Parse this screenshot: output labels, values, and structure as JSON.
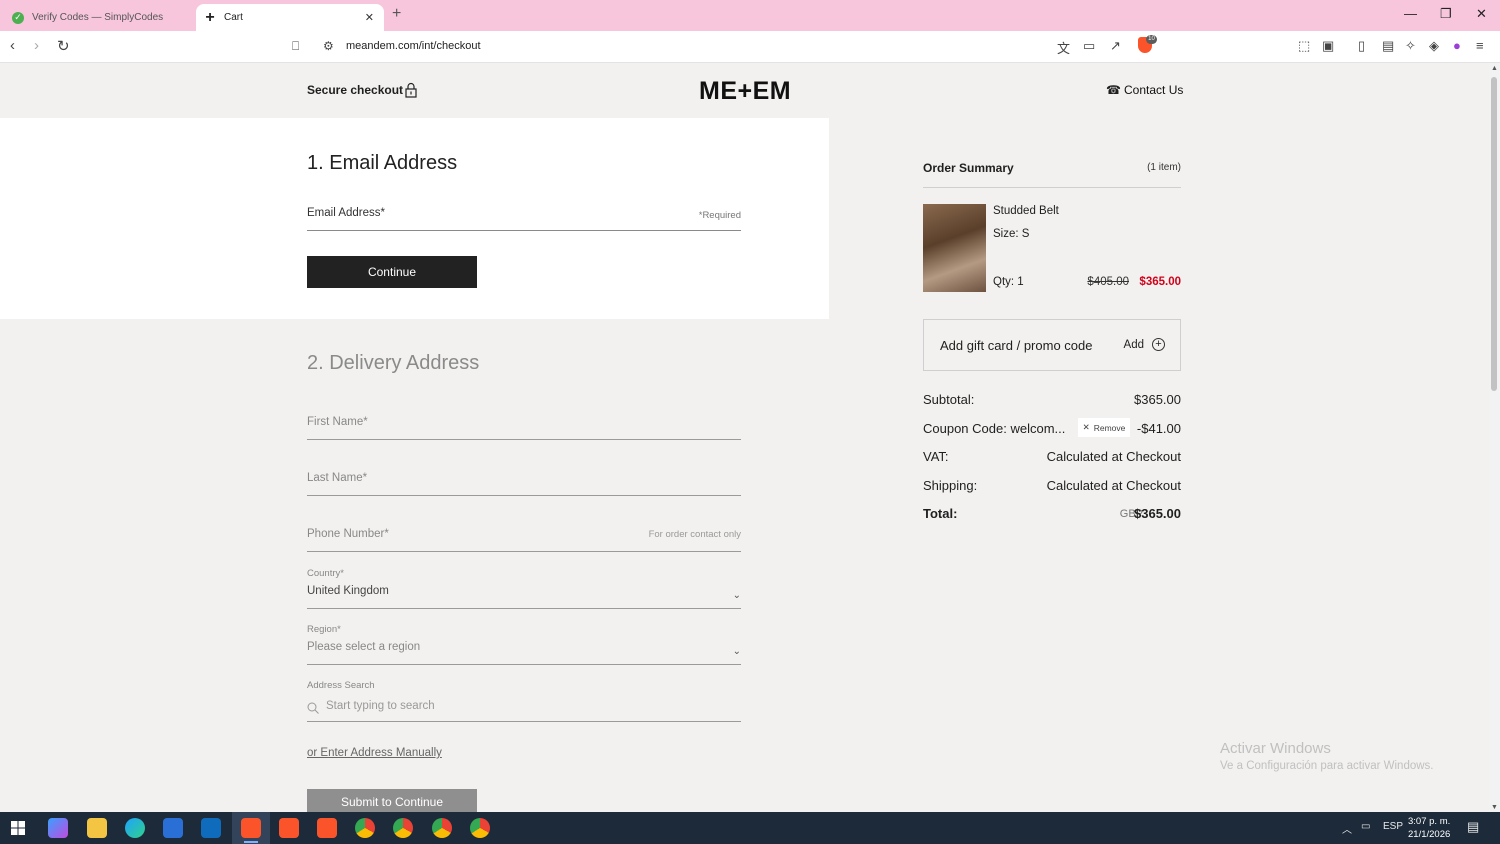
{
  "browser": {
    "tabs": [
      {
        "title": "Verify Codes — SimplyCodes",
        "active": false
      },
      {
        "title": "Cart",
        "active": true
      }
    ],
    "url": "meandem.com/int/checkout",
    "brave_badge": "10"
  },
  "header": {
    "secure_label": "Secure checkout",
    "logo": "ME+EM",
    "contact_label": "Contact Us"
  },
  "email_section": {
    "title": "1. Email Address",
    "email_label": "Email Address*",
    "required_note": "*Required",
    "continue_label": "Continue"
  },
  "delivery_section": {
    "title": "2. Delivery Address",
    "first_name_label": "First Name*",
    "last_name_label": "Last Name*",
    "phone_label": "Phone Number*",
    "phone_note": "For order contact only",
    "country_label": "Country*",
    "country_value": "United Kingdom",
    "region_label": "Region*",
    "region_placeholder": "Please select a region",
    "address_search_label": "Address Search",
    "address_search_placeholder": "Start typing to search",
    "manual_link": "or Enter Address Manually",
    "submit_label": "Submit to Continue"
  },
  "summary": {
    "title": "Order Summary",
    "count": "(1 item)",
    "product": {
      "name": "Studded Belt",
      "size": "Size: S",
      "qty": "Qty: 1",
      "old_price": "$405.00",
      "price": "$365.00"
    },
    "promo_label": "Add gift card / promo code",
    "promo_add": "Add",
    "rows": {
      "subtotal_label": "Subtotal:",
      "subtotal_value": "$365.00",
      "coupon_label": "Coupon Code: welcom...",
      "remove_label": "Remove",
      "coupon_value": "-$41.00",
      "vat_label": "VAT:",
      "vat_value": "Calculated at Checkout",
      "shipping_label": "Shipping:",
      "shipping_value": "Calculated at Checkout",
      "total_label": "Total:",
      "total_currency": "GBP",
      "total_value": "$365.00"
    }
  },
  "watermark": {
    "line1": "Activar Windows",
    "line2": "Ve a Configuración para activar Windows."
  },
  "taskbar": {
    "language": "ESP",
    "time": "3:07 p. m.",
    "date": "21/1/2026"
  },
  "colors": {
    "tabbar": "#f7c6dc",
    "sale_price": "#d0021b",
    "button_dark": "#222222",
    "button_disabled": "#8f8f8f",
    "page_bg": "#f2f1ef"
  }
}
